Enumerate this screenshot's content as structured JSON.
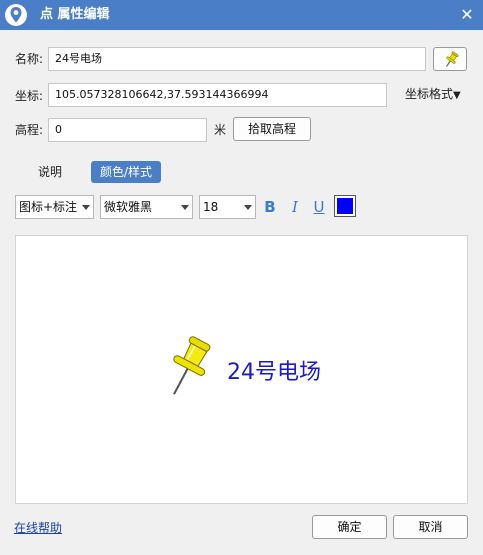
{
  "window": {
    "title": "点 属性编辑",
    "close_glyph": "✕"
  },
  "form": {
    "name_label": "名称:",
    "name_value": "24号电场",
    "coord_label": "坐标:",
    "coord_value": "105.057328106642,37.593144366994",
    "coord_format_label": "坐标格式",
    "coord_format_glyph": "▼",
    "elevation_label": "高程:",
    "elevation_value": "0",
    "elevation_unit": "米",
    "pick_elevation_button": "拾取高程"
  },
  "tabs": [
    {
      "label": "说明",
      "active": false
    },
    {
      "label": "颜色/样式",
      "active": true
    }
  ],
  "style": {
    "display_mode": "图标+标注",
    "font_name": "微软雅黑",
    "font_size": "18",
    "bold_glyph": "B",
    "italic_glyph": "I",
    "underline_glyph": "U",
    "text_color": "#0000ff"
  },
  "preview": {
    "label": "24号电场"
  },
  "footer": {
    "help_link": "在线帮助",
    "ok_button": "确定",
    "cancel_button": "取消"
  },
  "colors": {
    "titlebar": "#4a7fc8",
    "pin_yellow": "#f0e000",
    "label_blue": "#1a1acc"
  },
  "icons": {
    "title": "map-pin-icon",
    "pick": "pushpin-icon",
    "preview": "pushpin-icon"
  }
}
